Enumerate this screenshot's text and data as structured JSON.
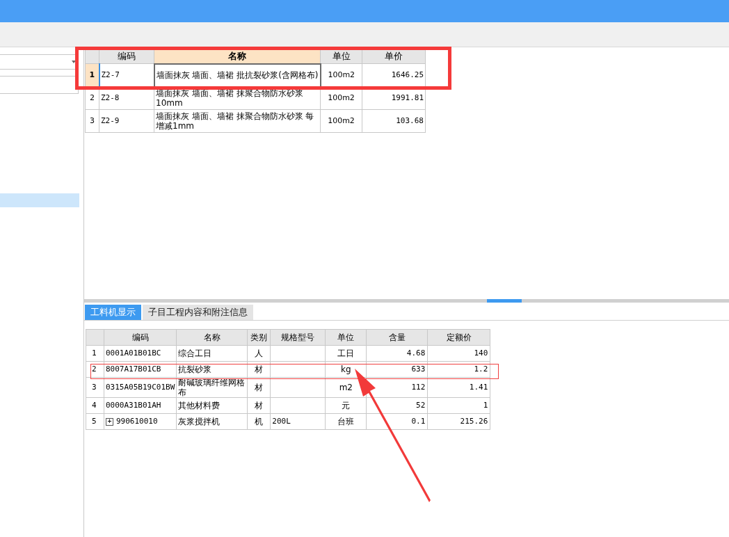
{
  "top_table": {
    "columns": [
      "编码",
      "名称",
      "单位",
      "单价"
    ],
    "rows": [
      {
        "index": "1",
        "selected": true,
        "code": "Z2-7",
        "name": "墙面抹灰 墙面、墙裙 批抗裂砂浆(含网格布)",
        "unit": "100m2",
        "price": "1646.25"
      },
      {
        "index": "2",
        "selected": false,
        "code": "Z2-8",
        "name": "墙面抹灰 墙面、墙裙 抹聚合物防水砂浆 10mm",
        "unit": "100m2",
        "price": "1991.81"
      },
      {
        "index": "3",
        "selected": false,
        "code": "Z2-9",
        "name": "墙面抹灰 墙面、墙裙 抹聚合物防水砂浆 每增减1mm",
        "unit": "100m2",
        "price": "103.68"
      }
    ]
  },
  "tabs": [
    {
      "label": "工料机显示",
      "selected": true
    },
    {
      "label": "子目工程内容和附注信息",
      "selected": false
    }
  ],
  "bottom_table": {
    "columns": [
      "编码",
      "名称",
      "类别",
      "规格型号",
      "单位",
      "含量",
      "定额价"
    ],
    "rows": [
      {
        "index": "1",
        "expandable": false,
        "code": "0001A01B01BC",
        "name": "综合工日",
        "type": "人",
        "spec": "",
        "unit": "工日",
        "qty": "4.68",
        "price": "140"
      },
      {
        "index": "2",
        "expandable": false,
        "code": "8007A17B01CB",
        "name": "抗裂砂浆",
        "type": "材",
        "spec": "",
        "unit": "kg",
        "qty": "633",
        "price": "1.2"
      },
      {
        "index": "3",
        "expandable": false,
        "code": "0315A05B19C01BW",
        "name": "耐碱玻璃纤维网格布",
        "type": "材",
        "spec": "",
        "unit": "m2",
        "qty": "112",
        "price": "1.41"
      },
      {
        "index": "4",
        "expandable": false,
        "code": "0000A31B01AH",
        "name": "其他材料费",
        "type": "材",
        "spec": "",
        "unit": "元",
        "qty": "52",
        "price": "1"
      },
      {
        "index": "5",
        "expandable": true,
        "expand_glyph": "+",
        "code": "990610010",
        "name": "灰浆搅拌机",
        "type": "机",
        "spec": "200L",
        "unit": "台班",
        "qty": "0.1",
        "price": "215.26"
      }
    ]
  }
}
